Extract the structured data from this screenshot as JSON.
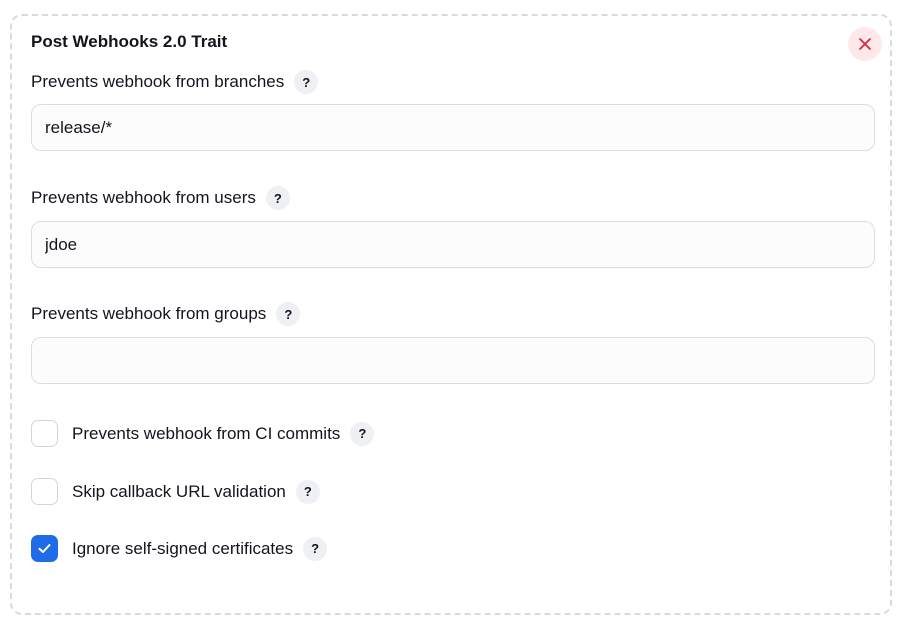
{
  "title": "Post Webhooks 2.0 Trait",
  "help_glyph": "?",
  "colors": {
    "accent": "#1f6be8",
    "close_icon": "#d62a3a",
    "close_bg": "#fde8ea"
  },
  "fields": [
    {
      "label": "Prevents webhook from branches",
      "value": "release/*",
      "placeholder": ""
    },
    {
      "label": "Prevents webhook from users",
      "value": "jdoe",
      "placeholder": ""
    },
    {
      "label": "Prevents webhook from groups",
      "value": "",
      "placeholder": ""
    }
  ],
  "checkboxes": [
    {
      "label": "Prevents webhook from CI commits",
      "checked": false
    },
    {
      "label": "Skip callback URL validation",
      "checked": false
    },
    {
      "label": "Ignore self-signed certificates",
      "checked": true
    }
  ],
  "icons": {
    "close": "close-icon",
    "help": "help-icon",
    "check": "checkmark-icon"
  }
}
